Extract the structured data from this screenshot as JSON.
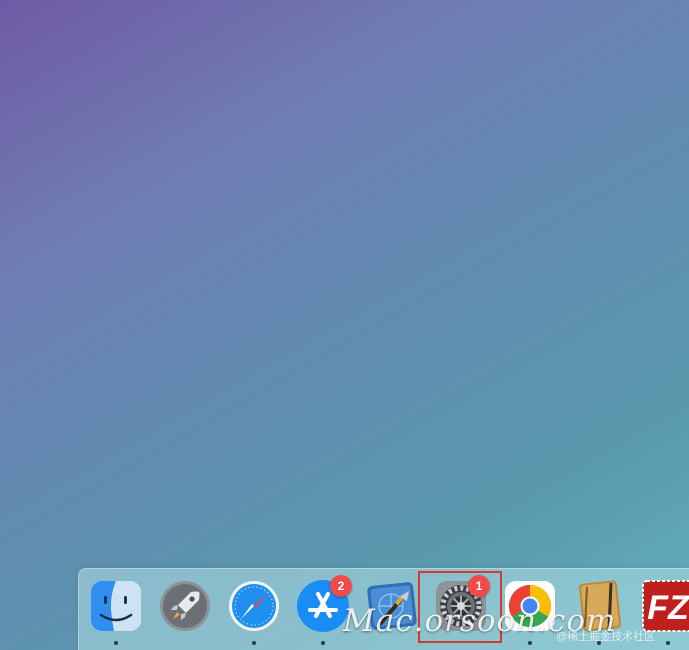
{
  "desktop": {
    "dock": {
      "items": [
        {
          "name": "Finder",
          "icon": "finder-icon",
          "running": true,
          "badge": null
        },
        {
          "name": "Launchpad",
          "icon": "launchpad-icon",
          "running": false,
          "badge": null
        },
        {
          "name": "Safari",
          "icon": "safari-icon",
          "running": true,
          "badge": null
        },
        {
          "name": "App Store",
          "icon": "app-store-icon",
          "running": true,
          "badge": "2"
        },
        {
          "name": "Xcode",
          "icon": "xcode-icon",
          "running": false,
          "badge": null
        },
        {
          "name": "System Preferences",
          "icon": "system-preferences-icon",
          "running": false,
          "badge": "1",
          "highlighted": true
        },
        {
          "name": "Google Chrome",
          "icon": "chrome-icon",
          "running": true,
          "badge": null
        },
        {
          "name": "Notes",
          "icon": "notebook-icon",
          "running": true,
          "badge": null
        },
        {
          "name": "FileZilla",
          "icon": "filezilla-icon",
          "running": true,
          "badge": null
        }
      ]
    },
    "highlight_color": "#d23a32",
    "badge_color": "#f04a4a"
  },
  "overlay": {
    "watermark": "Mac.orsoon.com",
    "credit": "@稀土掘金技术社区"
  }
}
